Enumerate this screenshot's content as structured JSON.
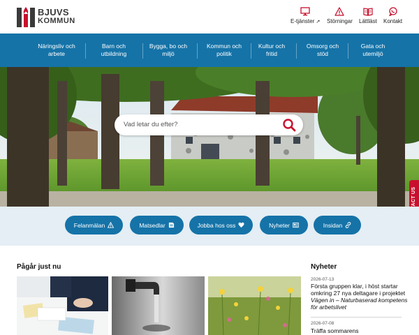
{
  "brand": {
    "line1": "BJUVS",
    "line2": "KOMMUN",
    "color": "#c8102e"
  },
  "utility": [
    {
      "label": "E-tjänster",
      "icon": "monitor-icon"
    },
    {
      "label": "Störningar",
      "icon": "warning-icon"
    },
    {
      "label": "Lättläst",
      "icon": "book-icon"
    },
    {
      "label": "Kontakt",
      "icon": "chat-icon"
    }
  ],
  "nav": [
    {
      "line1": "Näringsliv och",
      "line2": "arbete"
    },
    {
      "line1": "Barn och",
      "line2": "utbildning"
    },
    {
      "line1": "Bygga, bo och",
      "line2": "miljö"
    },
    {
      "line1": "Kommun och",
      "line2": "politik"
    },
    {
      "line1": "Kultur och",
      "line2": "fritid"
    },
    {
      "line1": "Omsorg och",
      "line2": "stöd"
    },
    {
      "line1": "Gata och",
      "line2": "utemiljö"
    }
  ],
  "search": {
    "placeholder": "Vad letar du efter?"
  },
  "contact_tab": "CONTACT US",
  "quick_links": [
    {
      "label": "Felanmälan",
      "icon": "warning-icon"
    },
    {
      "label": "Matsedlar",
      "icon": "menu-icon"
    },
    {
      "label": "Jobba hos oss",
      "icon": "heart-icon"
    },
    {
      "label": "Nyheter",
      "icon": "news-icon"
    },
    {
      "label": "Insidan",
      "icon": "link-icon"
    }
  ],
  "ongoing": {
    "title": "Pågår just nu"
  },
  "news": {
    "title": "Nyheter",
    "items": [
      {
        "date": "2026-07-13",
        "text_plain": "Första gruppen klar, i höst startar omkring 27 nya deltagare i projektet ",
        "text_em": "Vägen in – Naturbaserad kompetens för arbetslivet"
      },
      {
        "date": "2026-07-08",
        "text_plain": "Träffa sommarens"
      }
    ]
  },
  "colors": {
    "primary": "#1573a8",
    "accent": "#c8102e",
    "quick_bg": "#e4eef4"
  }
}
